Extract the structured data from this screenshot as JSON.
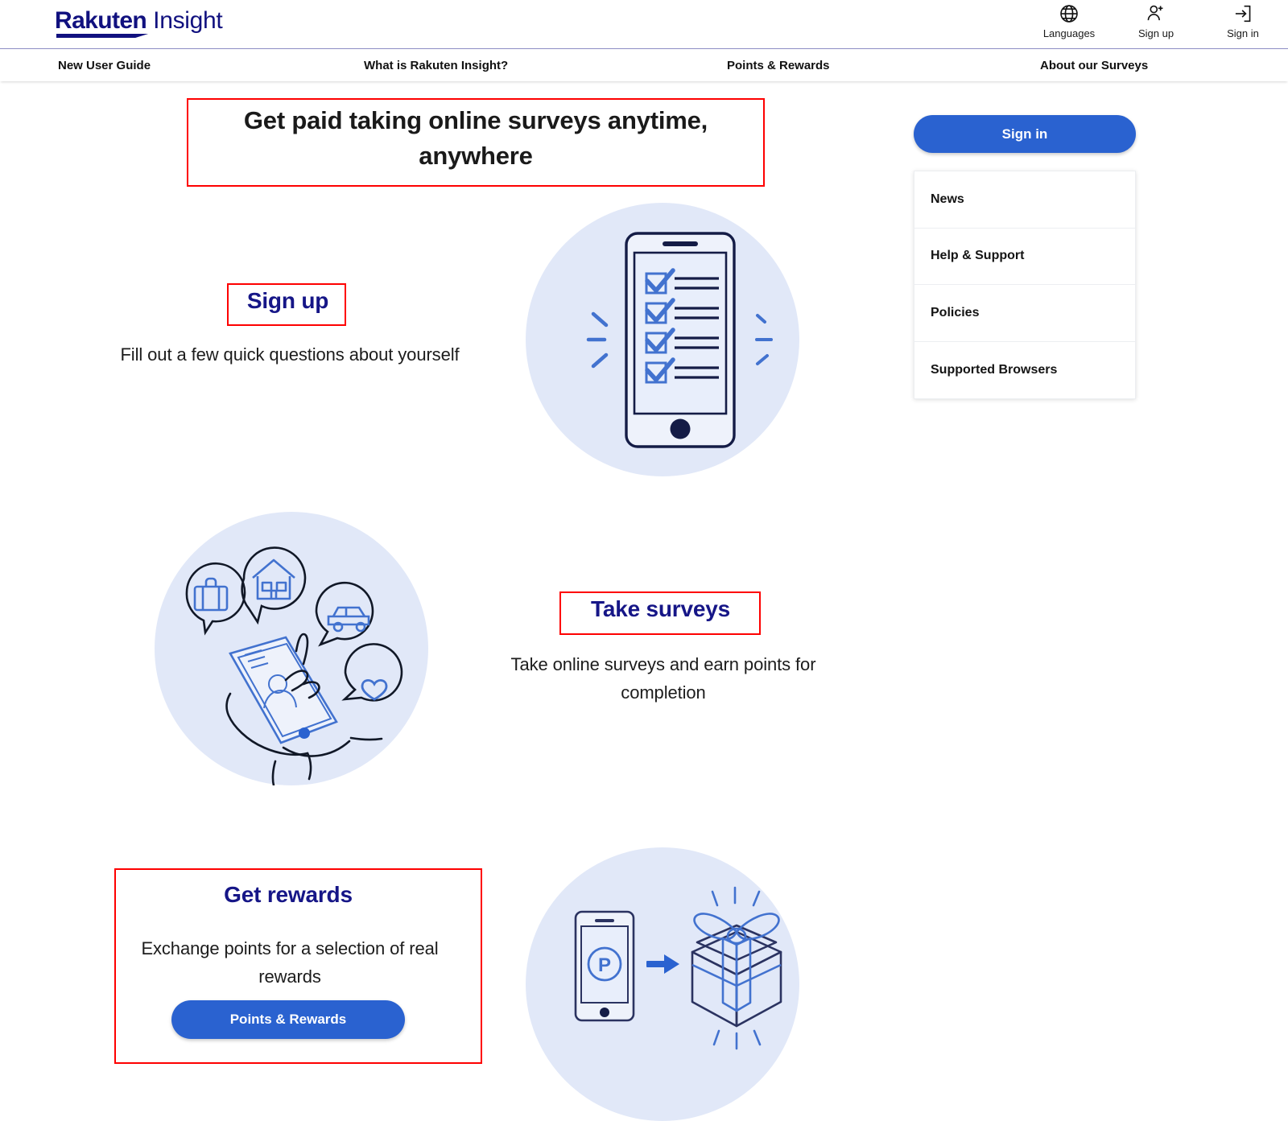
{
  "header": {
    "logo": {
      "primary": "Rakuten",
      "secondary": "Insight"
    },
    "actions": [
      {
        "icon": "globe-icon",
        "label": "Languages"
      },
      {
        "icon": "user-plus-icon",
        "label": "Sign up"
      },
      {
        "icon": "sign-in-icon",
        "label": "Sign in"
      }
    ]
  },
  "nav": {
    "items": [
      {
        "label": "New User Guide"
      },
      {
        "label": "What is Rakuten Insight?"
      },
      {
        "label": "Points & Rewards"
      },
      {
        "label": "About our Surveys"
      }
    ]
  },
  "hero": {
    "title": "Get paid taking online surveys anytime, anywhere"
  },
  "sidebar": {
    "signin_label": "Sign in",
    "links": [
      {
        "label": "News"
      },
      {
        "label": "Help & Support"
      },
      {
        "label": "Policies"
      },
      {
        "label": "Supported Browsers"
      }
    ]
  },
  "features": [
    {
      "title": "Sign up",
      "description": "Fill out a few quick questions about yourself",
      "illustration": "phone-checklist-illustration"
    },
    {
      "title": "Take surveys",
      "description": "Take online surveys and earn points for completion",
      "illustration": "hand-phone-bubbles-illustration"
    },
    {
      "title": "Get rewards",
      "description": "Exchange points for a selection of real rewards",
      "button_label": "Points & Rewards",
      "illustration": "points-to-gift-illustration"
    }
  ],
  "colors": {
    "brand_navy": "#11117f",
    "accent_blue": "#2a62d0",
    "heading_blue": "#161687",
    "illustration_bg": "#e1e8f8",
    "annotation_red": "#fe0000",
    "nav_top_border": "#8d8dc4"
  }
}
